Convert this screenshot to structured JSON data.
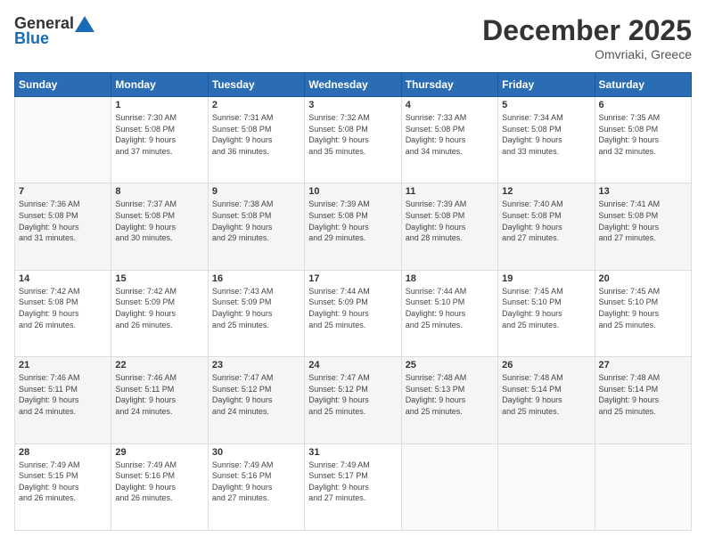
{
  "logo": {
    "general": "General",
    "blue": "Blue"
  },
  "title": "December 2025",
  "location": "Omvriaki, Greece",
  "days_of_week": [
    "Sunday",
    "Monday",
    "Tuesday",
    "Wednesday",
    "Thursday",
    "Friday",
    "Saturday"
  ],
  "weeks": [
    [
      {
        "num": "",
        "info": ""
      },
      {
        "num": "1",
        "info": "Sunrise: 7:30 AM\nSunset: 5:08 PM\nDaylight: 9 hours\nand 37 minutes."
      },
      {
        "num": "2",
        "info": "Sunrise: 7:31 AM\nSunset: 5:08 PM\nDaylight: 9 hours\nand 36 minutes."
      },
      {
        "num": "3",
        "info": "Sunrise: 7:32 AM\nSunset: 5:08 PM\nDaylight: 9 hours\nand 35 minutes."
      },
      {
        "num": "4",
        "info": "Sunrise: 7:33 AM\nSunset: 5:08 PM\nDaylight: 9 hours\nand 34 minutes."
      },
      {
        "num": "5",
        "info": "Sunrise: 7:34 AM\nSunset: 5:08 PM\nDaylight: 9 hours\nand 33 minutes."
      },
      {
        "num": "6",
        "info": "Sunrise: 7:35 AM\nSunset: 5:08 PM\nDaylight: 9 hours\nand 32 minutes."
      }
    ],
    [
      {
        "num": "7",
        "info": "Sunrise: 7:36 AM\nSunset: 5:08 PM\nDaylight: 9 hours\nand 31 minutes."
      },
      {
        "num": "8",
        "info": "Sunrise: 7:37 AM\nSunset: 5:08 PM\nDaylight: 9 hours\nand 30 minutes."
      },
      {
        "num": "9",
        "info": "Sunrise: 7:38 AM\nSunset: 5:08 PM\nDaylight: 9 hours\nand 29 minutes."
      },
      {
        "num": "10",
        "info": "Sunrise: 7:39 AM\nSunset: 5:08 PM\nDaylight: 9 hours\nand 29 minutes."
      },
      {
        "num": "11",
        "info": "Sunrise: 7:39 AM\nSunset: 5:08 PM\nDaylight: 9 hours\nand 28 minutes."
      },
      {
        "num": "12",
        "info": "Sunrise: 7:40 AM\nSunset: 5:08 PM\nDaylight: 9 hours\nand 27 minutes."
      },
      {
        "num": "13",
        "info": "Sunrise: 7:41 AM\nSunset: 5:08 PM\nDaylight: 9 hours\nand 27 minutes."
      }
    ],
    [
      {
        "num": "14",
        "info": "Sunrise: 7:42 AM\nSunset: 5:08 PM\nDaylight: 9 hours\nand 26 minutes."
      },
      {
        "num": "15",
        "info": "Sunrise: 7:42 AM\nSunset: 5:09 PM\nDaylight: 9 hours\nand 26 minutes."
      },
      {
        "num": "16",
        "info": "Sunrise: 7:43 AM\nSunset: 5:09 PM\nDaylight: 9 hours\nand 25 minutes."
      },
      {
        "num": "17",
        "info": "Sunrise: 7:44 AM\nSunset: 5:09 PM\nDaylight: 9 hours\nand 25 minutes."
      },
      {
        "num": "18",
        "info": "Sunrise: 7:44 AM\nSunset: 5:10 PM\nDaylight: 9 hours\nand 25 minutes."
      },
      {
        "num": "19",
        "info": "Sunrise: 7:45 AM\nSunset: 5:10 PM\nDaylight: 9 hours\nand 25 minutes."
      },
      {
        "num": "20",
        "info": "Sunrise: 7:45 AM\nSunset: 5:10 PM\nDaylight: 9 hours\nand 25 minutes."
      }
    ],
    [
      {
        "num": "21",
        "info": "Sunrise: 7:46 AM\nSunset: 5:11 PM\nDaylight: 9 hours\nand 24 minutes."
      },
      {
        "num": "22",
        "info": "Sunrise: 7:46 AM\nSunset: 5:11 PM\nDaylight: 9 hours\nand 24 minutes."
      },
      {
        "num": "23",
        "info": "Sunrise: 7:47 AM\nSunset: 5:12 PM\nDaylight: 9 hours\nand 24 minutes."
      },
      {
        "num": "24",
        "info": "Sunrise: 7:47 AM\nSunset: 5:12 PM\nDaylight: 9 hours\nand 25 minutes."
      },
      {
        "num": "25",
        "info": "Sunrise: 7:48 AM\nSunset: 5:13 PM\nDaylight: 9 hours\nand 25 minutes."
      },
      {
        "num": "26",
        "info": "Sunrise: 7:48 AM\nSunset: 5:14 PM\nDaylight: 9 hours\nand 25 minutes."
      },
      {
        "num": "27",
        "info": "Sunrise: 7:48 AM\nSunset: 5:14 PM\nDaylight: 9 hours\nand 25 minutes."
      }
    ],
    [
      {
        "num": "28",
        "info": "Sunrise: 7:49 AM\nSunset: 5:15 PM\nDaylight: 9 hours\nand 26 minutes."
      },
      {
        "num": "29",
        "info": "Sunrise: 7:49 AM\nSunset: 5:16 PM\nDaylight: 9 hours\nand 26 minutes."
      },
      {
        "num": "30",
        "info": "Sunrise: 7:49 AM\nSunset: 5:16 PM\nDaylight: 9 hours\nand 27 minutes."
      },
      {
        "num": "31",
        "info": "Sunrise: 7:49 AM\nSunset: 5:17 PM\nDaylight: 9 hours\nand 27 minutes."
      },
      {
        "num": "",
        "info": ""
      },
      {
        "num": "",
        "info": ""
      },
      {
        "num": "",
        "info": ""
      }
    ]
  ]
}
